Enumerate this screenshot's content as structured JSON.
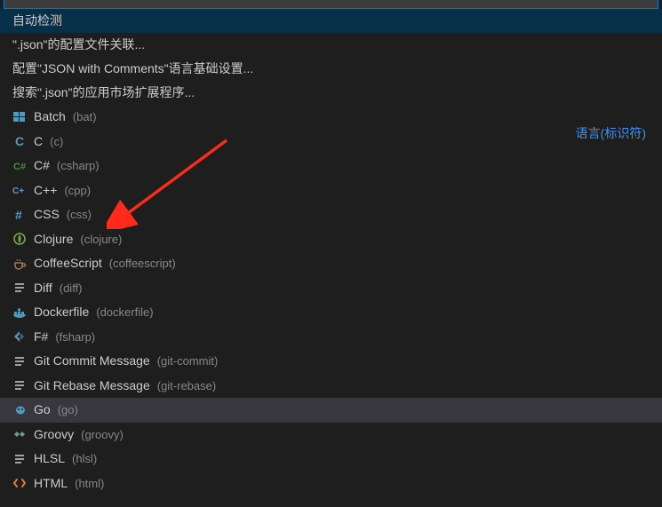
{
  "header_label": "语言(标识符)",
  "menu": {
    "auto_detect": "自动检测",
    "configure_association": "\".json\"的配置文件关联...",
    "configure_basics": "配置\"JSON with Comments\"语言基础设置...",
    "search_marketplace": "搜索\".json\"的应用市场扩展程序..."
  },
  "languages": [
    {
      "name": "Batch",
      "id": "bat",
      "icon": "windows",
      "color": "#519aba"
    },
    {
      "name": "C",
      "id": "c",
      "icon": "letter-c",
      "color": "#519aba"
    },
    {
      "name": "C#",
      "id": "csharp",
      "icon": "csharp",
      "color": "#498e3f"
    },
    {
      "name": "C++",
      "id": "cpp",
      "icon": "cpp",
      "color": "#649ad2"
    },
    {
      "name": "CSS",
      "id": "css",
      "icon": "hash",
      "color": "#519aba"
    },
    {
      "name": "Clojure",
      "id": "clojure",
      "icon": "clojure",
      "color": "#7fae42"
    },
    {
      "name": "CoffeeScript",
      "id": "coffeescript",
      "icon": "coffee",
      "color": "#a07753"
    },
    {
      "name": "Diff",
      "id": "diff",
      "icon": "lines",
      "color": "#cccccc"
    },
    {
      "name": "Dockerfile",
      "id": "dockerfile",
      "icon": "docker",
      "color": "#519aba"
    },
    {
      "name": "F#",
      "id": "fsharp",
      "icon": "fsharp",
      "color": "#519aba"
    },
    {
      "name": "Git Commit Message",
      "id": "git-commit",
      "icon": "lines",
      "color": "#cccccc"
    },
    {
      "name": "Git Rebase Message",
      "id": "git-rebase",
      "icon": "lines",
      "color": "#cccccc"
    },
    {
      "name": "Go",
      "id": "go",
      "icon": "go",
      "color": "#519aba",
      "hover": true
    },
    {
      "name": "Groovy",
      "id": "groovy",
      "icon": "groovy",
      "color": "#6ba088"
    },
    {
      "name": "HLSL",
      "id": "hlsl",
      "icon": "lines",
      "color": "#cccccc"
    },
    {
      "name": "HTML",
      "id": "html",
      "icon": "code",
      "color": "#e37933"
    }
  ]
}
